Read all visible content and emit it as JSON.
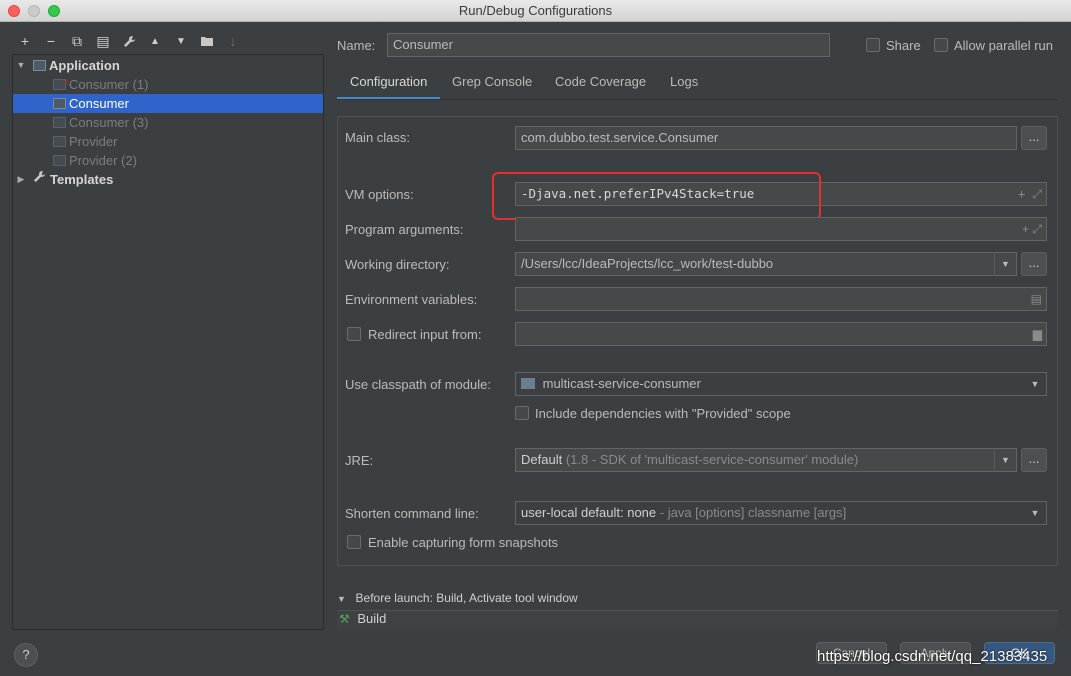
{
  "window": {
    "title": "Run/Debug Configurations"
  },
  "toolbar": {
    "add": "+",
    "remove": "−",
    "copy": "⧉",
    "save": "▤",
    "edit": "🔧",
    "up": "▲",
    "down": "▼",
    "folder": "▆",
    "sort": "↓"
  },
  "tree": {
    "application_label": "Application",
    "items": [
      {
        "label": "Consumer (1)"
      },
      {
        "label": "Consumer"
      },
      {
        "label": "Consumer (3)"
      },
      {
        "label": "Provider"
      },
      {
        "label": "Provider (2)"
      }
    ],
    "templates_label": "Templates"
  },
  "header": {
    "name_label": "Name:",
    "name_value": "Consumer",
    "share_label": "Share",
    "parallel_label": "Allow parallel run"
  },
  "tabs": [
    {
      "label": "Configuration"
    },
    {
      "label": "Grep Console"
    },
    {
      "label": "Code Coverage"
    },
    {
      "label": "Logs"
    }
  ],
  "form": {
    "main_class_label": "Main class:",
    "main_class_value": "com.dubbo.test.service.Consumer",
    "vm_options_label": "VM options:",
    "vm_options_value": "-Djava.net.preferIPv4Stack=true",
    "program_args_label": "Program arguments:",
    "working_dir_label": "Working directory:",
    "working_dir_value": "/Users/lcc/IdeaProjects/lcc_work/test-dubbo",
    "env_vars_label": "Environment variables:",
    "redirect_label": "Redirect input from:",
    "classpath_label": "Use classpath of module:",
    "classpath_value": "multicast-service-consumer",
    "include_deps_label": "Include dependencies with \"Provided\" scope",
    "jre_label": "JRE:",
    "jre_value_main": "Default",
    "jre_value_detail": "(1.8 - SDK of 'multicast-service-consumer' module)",
    "shorten_label": "Shorten command line:",
    "shorten_value_main": "user-local default: none",
    "shorten_value_detail": "- java [options] classname [args]",
    "snapshots_label": "Enable capturing form snapshots",
    "browse": "..."
  },
  "before_launch": {
    "label": "Before launch: Build, Activate tool window",
    "build_label": "Build"
  },
  "footer": {
    "help": "?",
    "cancel": "Cancel",
    "apply": "Apply",
    "ok": "OK",
    "watermark": "https://blog.csdn.net/qq_21383435"
  },
  "colors": {
    "selection": "#2f65ca",
    "highlight_box": "#e0302f",
    "tab_underline": "#4a88c7"
  }
}
